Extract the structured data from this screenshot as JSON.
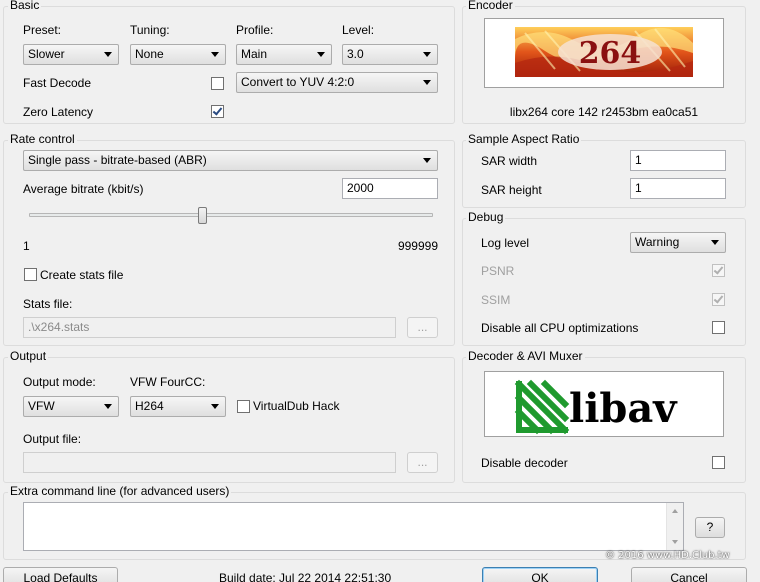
{
  "basic": {
    "title": "Basic",
    "preset_label": "Preset:",
    "preset_value": "Slower",
    "tuning_label": "Tuning:",
    "tuning_value": "None",
    "profile_label": "Profile:",
    "profile_value": "Main",
    "level_label": "Level:",
    "level_value": "3.0",
    "fast_decode_label": "Fast Decode",
    "fast_decode_checked": false,
    "colorspace_value": "Convert to YUV 4:2:0",
    "zero_latency_label": "Zero Latency",
    "zero_latency_checked": true
  },
  "encoder": {
    "title": "Encoder",
    "logo_text": "264",
    "version_text": "libx264 core 142 r2453bm ea0ca51"
  },
  "rate_control": {
    "title": "Rate control",
    "mode_value": "Single pass - bitrate-based (ABR)",
    "bitrate_label": "Average bitrate (kbit/s)",
    "bitrate_value": "2000",
    "slider_min": "1",
    "slider_max": "999999",
    "slider_fraction": 0.43,
    "create_stats_label": "Create stats file",
    "create_stats_checked": false,
    "stats_file_label": "Stats file:",
    "stats_file_value": ".\\x264.stats",
    "browse_label": "..."
  },
  "sar": {
    "title": "Sample Aspect Ratio",
    "width_label": "SAR width",
    "width_value": "1",
    "height_label": "SAR height",
    "height_value": "1"
  },
  "debug": {
    "title": "Debug",
    "log_level_label": "Log level",
    "log_level_value": "Warning",
    "psnr_label": "PSNR",
    "psnr_checked": true,
    "ssim_label": "SSIM",
    "ssim_checked": true,
    "disable_cpu_label": "Disable all CPU optimizations",
    "disable_cpu_checked": false
  },
  "output": {
    "title": "Output",
    "mode_label": "Output mode:",
    "mode_value": "VFW",
    "fourcc_label": "VFW FourCC:",
    "fourcc_value": "H264",
    "vdub_hack_label": "VirtualDub Hack",
    "vdub_hack_checked": false,
    "file_label": "Output file:",
    "file_value": "",
    "browse_label": "..."
  },
  "decoder": {
    "title": "Decoder & AVI Muxer",
    "logo_text": "libav",
    "disable_decoder_label": "Disable decoder",
    "disable_decoder_checked": false
  },
  "extra": {
    "title": "Extra command line (for advanced users)",
    "value": "",
    "help_label": "?"
  },
  "footer": {
    "load_defaults_label": "Load Defaults",
    "build_date": "Build date: Jul 22 2014 22:51:30",
    "ok_label": "OK",
    "cancel_label": "Cancel"
  },
  "watermark": {
    "text": "© 2016 www.HD.Club.tw"
  },
  "colors": {
    "accent": "#3c7fb1",
    "disabled_text": "#a0a0a0",
    "libav_green": "#1f9a2e"
  }
}
